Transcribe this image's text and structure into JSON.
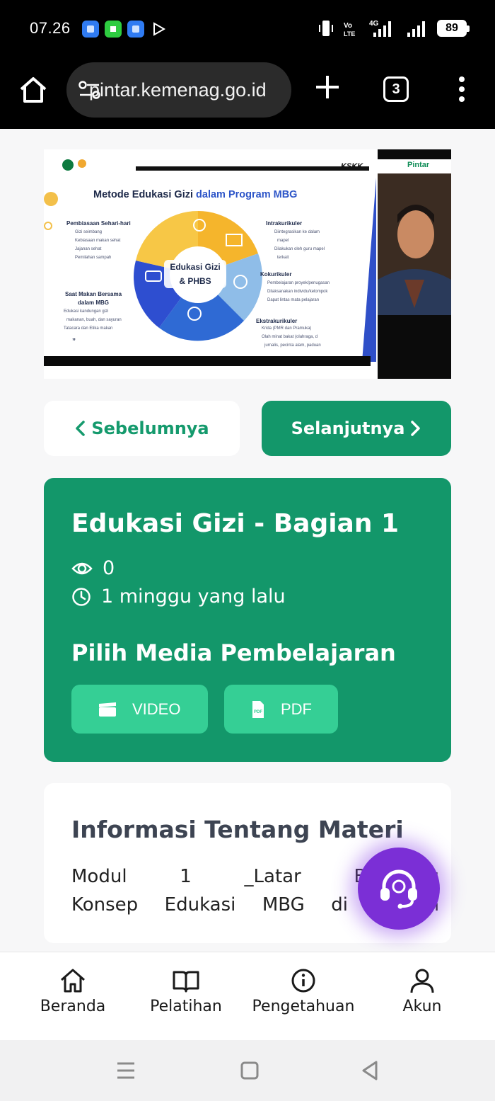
{
  "status_bar": {
    "time": "07.26",
    "battery": "89"
  },
  "browser": {
    "url": "pintar.kemenag.go.id",
    "tab_count": "3"
  },
  "slide": {
    "title_part1": "Metode Edukasi Gizi",
    "title_part2": "dalam Program MBG",
    "center_label_line1": "Edukasi Gizi",
    "center_label_line2": "& PHBS",
    "pembiasaan": {
      "heading": "Pembiasaan Sehari-hari",
      "items": [
        "Gizi seimbang",
        "Kebiasaan makan sehat",
        "Jajanan sehat",
        "Pemilahan sampah"
      ]
    },
    "makan": {
      "heading_line1": "Saat Makan Bersama",
      "heading_line2": "dalam MBG",
      "items": [
        "Edukasi kandungan gizi",
        "makanan, buah, dan sayuran",
        "Tatacara dan Etika makan"
      ]
    },
    "intrakurikuler": {
      "heading": "Intrakurikuler",
      "items": [
        "Diintegrasikan ke dalam",
        "mapel",
        "Dilakukan oleh guru mapel",
        "terkait"
      ]
    },
    "kokurikuler": {
      "heading": "Kokurikuler",
      "items": [
        "Pembelajaran proyek/penugasan",
        "Dilaksanakan individu/kelompok",
        "Dapat lintas mata pelajaran"
      ]
    },
    "ekstrakurikuler": {
      "heading": "Ekstrakurikuler",
      "items": [
        "Krida (PMR dan Pramuka)",
        "Olah minat bakat (olahraga, d",
        "jurnalis, pecinta alam, paduan"
      ]
    },
    "topbar_brand": "KSKK",
    "cam_brand": "Pintar"
  },
  "navigation": {
    "prev_label": "Sebelumnya",
    "next_label": "Selanjutnya"
  },
  "lesson": {
    "title": "Edukasi Gizi - Bagian 1",
    "views": "0",
    "time_ago": "1 minggu yang lalu",
    "media_heading": "Pilih Media Pembelajaran",
    "media_options": [
      "VIDEO",
      "PDF"
    ]
  },
  "info": {
    "title": "Informasi Tentang Materi",
    "line1": "Modul 1 _Latar Belakang",
    "line2": "Konsep Edukasi MBG di Satuan"
  },
  "bottom_nav": {
    "items": [
      "Beranda",
      "Pelatihan",
      "Pengetahuan",
      "Akun"
    ]
  },
  "colors": {
    "primary_green": "#13976a",
    "light_green": "#35cf95",
    "support_purple": "#7b2fd6"
  }
}
